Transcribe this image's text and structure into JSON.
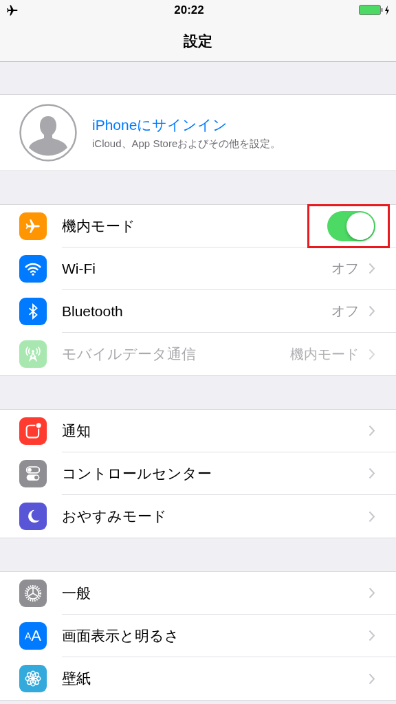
{
  "status_bar": {
    "time": "20:22"
  },
  "nav_bar": {
    "title": "設定"
  },
  "account": {
    "title": "iPhoneにサインイン",
    "subtitle": "iCloud、App Storeおよびその他を設定。"
  },
  "sections": [
    {
      "rows": [
        {
          "kind": "toggle",
          "label": "機内モード",
          "on": true,
          "highlighted": true,
          "color": "#ff9500"
        },
        {
          "kind": "link",
          "label": "Wi-Fi",
          "value": "オフ",
          "disabled": false,
          "color": "#007aff"
        },
        {
          "kind": "link",
          "label": "Bluetooth",
          "value": "オフ",
          "disabled": false,
          "color": "#007aff"
        },
        {
          "kind": "link",
          "label": "モバイルデータ通信",
          "value": "機内モード",
          "disabled": true,
          "color": "#a8e8b0"
        }
      ]
    },
    {
      "rows": [
        {
          "kind": "link",
          "label": "通知",
          "disabled": false,
          "color": "#ff3b30"
        },
        {
          "kind": "link",
          "label": "コントロールセンター",
          "disabled": false,
          "color": "#8e8e93"
        },
        {
          "kind": "link",
          "label": "おやすみモード",
          "disabled": false,
          "color": "#5856d6"
        }
      ]
    },
    {
      "rows": [
        {
          "kind": "link",
          "label": "一般",
          "disabled": false,
          "color": "#8e8e93"
        },
        {
          "kind": "link",
          "label": "画面表示と明るさ",
          "disabled": false,
          "color": "#007aff",
          "icon_text": "AA"
        },
        {
          "kind": "link",
          "label": "壁紙",
          "disabled": false,
          "color": "#34aadc"
        }
      ]
    }
  ]
}
